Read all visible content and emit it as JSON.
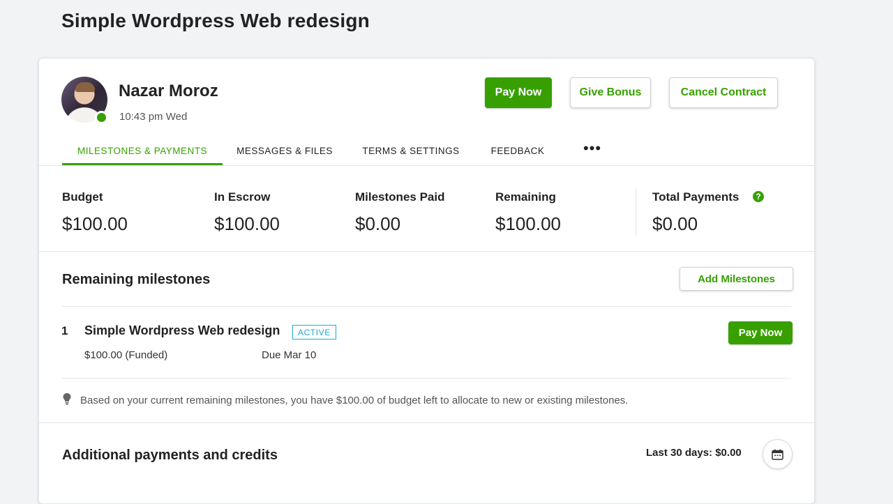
{
  "page": {
    "title": "Simple Wordpress Web redesign"
  },
  "freelancer": {
    "name": "Nazar Moroz",
    "local_time": "10:43 pm Wed"
  },
  "actions": {
    "pay_now": "Pay Now",
    "give_bonus": "Give Bonus",
    "cancel_contract": "Cancel Contract"
  },
  "tabs": [
    {
      "label": "MILESTONES & PAYMENTS",
      "active": true
    },
    {
      "label": "MESSAGES & FILES",
      "active": false
    },
    {
      "label": "TERMS & SETTINGS",
      "active": false
    },
    {
      "label": "FEEDBACK",
      "active": false
    },
    {
      "label": "•••",
      "active": false
    }
  ],
  "stats": [
    {
      "label": "Budget",
      "value": "$100.00"
    },
    {
      "label": "In Escrow",
      "value": "$100.00"
    },
    {
      "label": "Milestones Paid",
      "value": "$0.00"
    },
    {
      "label": "Remaining",
      "value": "$100.00"
    },
    {
      "label": "Total Payments",
      "value": "$0.00"
    }
  ],
  "remaining_milestones": {
    "title": "Remaining milestones",
    "add_label": "Add Milestones",
    "items": [
      {
        "number": "1",
        "title": "Simple Wordpress Web redesign",
        "status": "ACTIVE",
        "amount": "$100.00 (Funded)",
        "due": "Due Mar 10",
        "pay_label": "Pay Now"
      }
    ],
    "hint": "Based on your current remaining milestones, you have $100.00 of budget left to allocate to new or existing milestones."
  },
  "additional": {
    "title": "Additional payments and credits",
    "summary": "Last 30 days: $0.00"
  },
  "colors": {
    "accent": "#37a000",
    "badge": "#1fa7d8"
  },
  "icons": {
    "help": "question-circle-icon",
    "hint": "lightbulb-icon",
    "calendar": "calendar-icon",
    "status": "online-status-dot"
  }
}
